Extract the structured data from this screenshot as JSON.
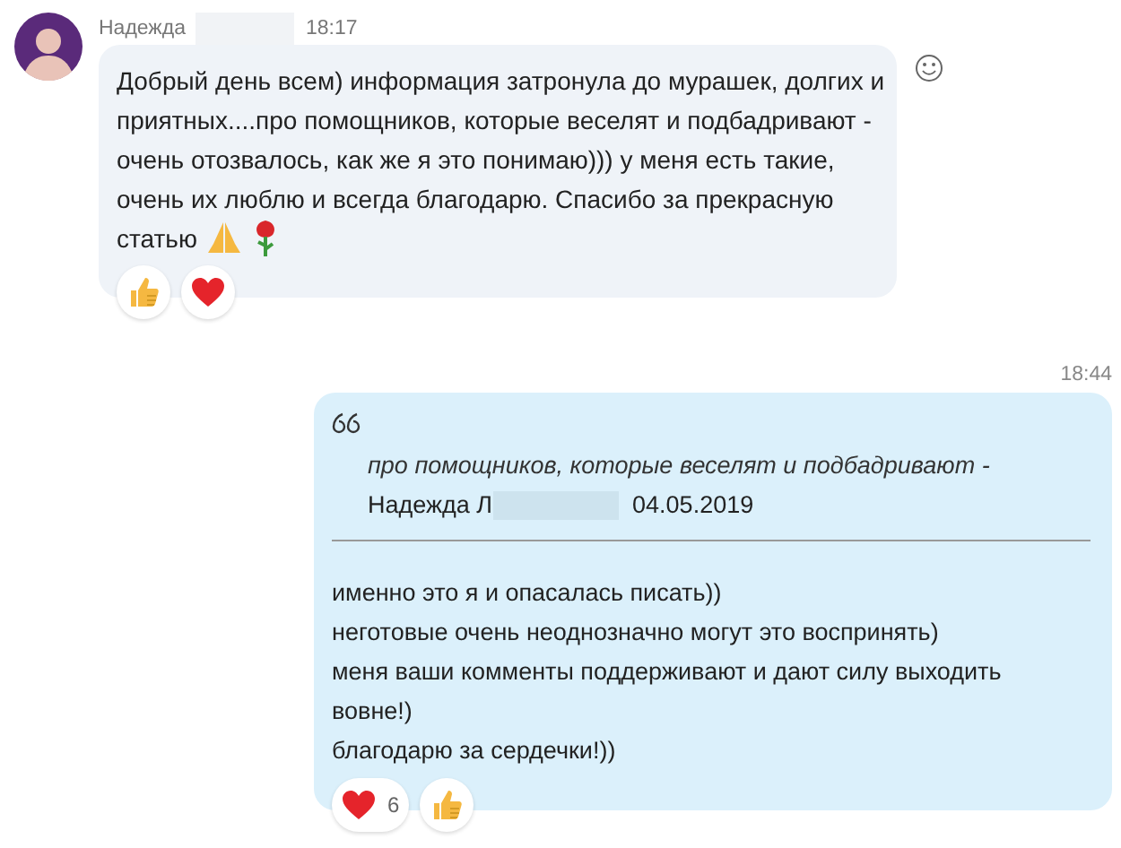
{
  "messages": [
    {
      "kind": "received",
      "sender": "Надежда",
      "time": "18:17",
      "lines": [
        "Добрый день всем) информация затронула до мурашек, долгих и",
        "приятных....про помощников, которые веселят и подбадривают -",
        "очень отозвалось, как же я это понимаю))) у меня есть такие,",
        "очень их люблю и всегда благодарю. Спасибо за прекрасную",
        "статью"
      ],
      "emojis": [
        {
          "kind": "pray"
        },
        {
          "kind": "rose"
        }
      ],
      "reactions": [
        {
          "kind": "like"
        },
        {
          "kind": "heart"
        }
      ]
    },
    {
      "kind": "sent",
      "time": "18:44",
      "quote": {
        "text": "про помощников, которые веселят и подбадривают -",
        "author": "Надежда Л",
        "date": "04.05.2019"
      },
      "lines": [
        "именно это я и опасалась писать))",
        "неготовые очень неоднозначно могут это воспринять)",
        "меня ваши комменты поддерживают и дают силу выходить",
        "вовне!)",
        "благодарю за сердечки!))"
      ],
      "reactions": [
        {
          "kind": "heart",
          "count": "6"
        },
        {
          "kind": "like"
        }
      ]
    }
  ]
}
